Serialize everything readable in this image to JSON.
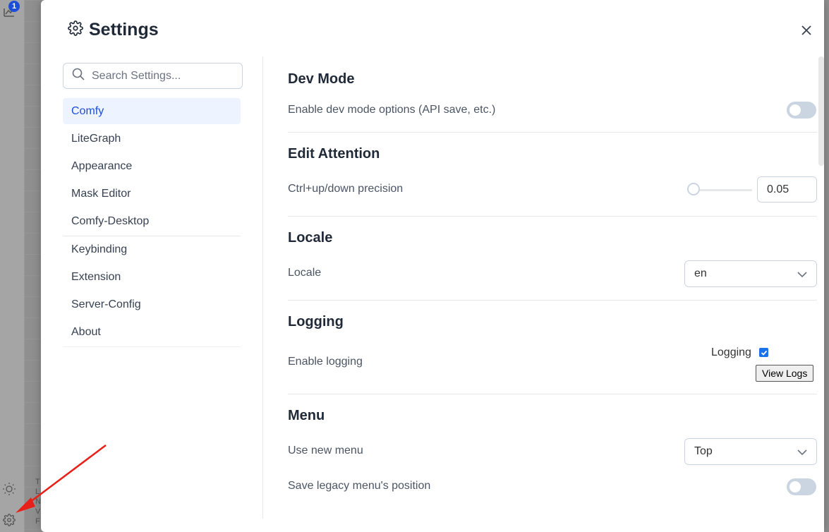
{
  "background": {
    "queue_badge_count": "1",
    "side_text": [
      "T",
      "L",
      "N",
      "V",
      "F"
    ]
  },
  "dialog": {
    "title": "Settings",
    "close_icon": "close-icon",
    "title_icon": "gear-icon"
  },
  "sidebar": {
    "search_placeholder": "Search Settings...",
    "items": [
      {
        "label": "Comfy",
        "active": true
      },
      {
        "label": "LiteGraph"
      },
      {
        "label": "Appearance"
      },
      {
        "label": "Mask Editor"
      },
      {
        "label": "Comfy-Desktop"
      },
      {
        "label": "Keybinding"
      },
      {
        "label": "Extension"
      },
      {
        "label": "Server-Config"
      },
      {
        "label": "About"
      }
    ]
  },
  "sections": {
    "dev_mode": {
      "title": "Dev Mode",
      "setting_label": "Enable dev mode options (API save, etc.)",
      "enabled": false
    },
    "edit_attention": {
      "title": "Edit Attention",
      "setting_label": "Ctrl+up/down precision",
      "value": "0.05",
      "slider_fraction": 0.0
    },
    "locale": {
      "title": "Locale",
      "setting_label": "Locale",
      "selected": "en"
    },
    "logging": {
      "title": "Logging",
      "setting_label": "Enable logging",
      "checkbox_label": "Logging",
      "checked": true,
      "view_logs_label": "View Logs"
    },
    "menu": {
      "title": "Menu",
      "use_new_menu_label": "Use new menu",
      "use_new_menu_value": "Top",
      "save_legacy_label": "Save legacy menu's position",
      "save_legacy_enabled": false
    }
  },
  "colors": {
    "accent": "#1d4ed8",
    "annotation_arrow": "#e8201a"
  }
}
